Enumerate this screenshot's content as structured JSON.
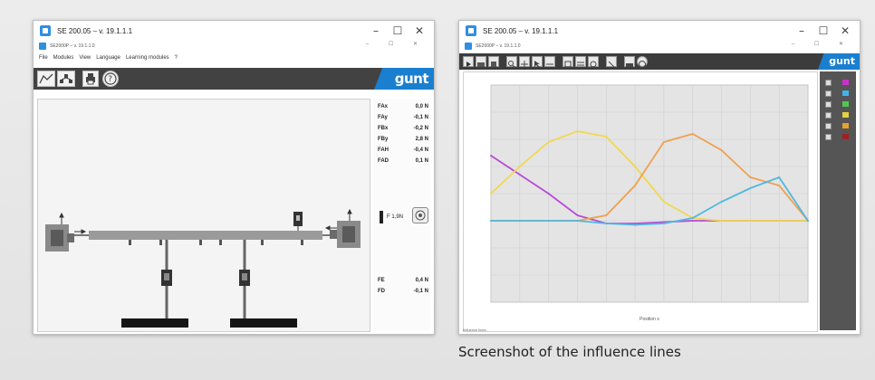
{
  "window1": {
    "title": "SE 200.05 – v. 19.1.1.1",
    "subtitle": "SE2000P – v. 19.1.1.0",
    "menu": [
      "File",
      "Modules",
      "View",
      "Language",
      "Learning modules",
      "?"
    ],
    "readouts_top": [
      {
        "label": "FAx",
        "value": "0,0 N"
      },
      {
        "label": "FAy",
        "value": "-0,1 N"
      },
      {
        "label": "FBx",
        "value": "-0,2 N"
      },
      {
        "label": "FBy",
        "value": "2,8 N"
      },
      {
        "label": "FAH",
        "value": "-0,4 N"
      },
      {
        "label": "FAD",
        "value": "0,1 N"
      }
    ],
    "readout_mid": "F 1,9N",
    "readouts_bottom": [
      {
        "label": "FE",
        "value": "0,4 N"
      },
      {
        "label": "FD",
        "value": "-0,1 N"
      }
    ],
    "logo": "gunt"
  },
  "window2": {
    "title": "SE 200.05 – v. 19.1.1.1",
    "subtitle": "SE2000P – v. 19.1.1.0",
    "logo": "gunt",
    "status": "Influence lines",
    "legend_colors": [
      "#ffffff",
      "#c832c8",
      "#40b4e8",
      "#50c850",
      "#e8d040",
      "#e8a030",
      "#a02020"
    ]
  },
  "chart_data": {
    "type": "line",
    "xlabel": "Position x",
    "x": [
      0,
      1,
      2,
      3,
      4,
      5,
      6,
      7,
      8,
      9,
      10,
      11
    ],
    "series": [
      {
        "color": "#b84ad8",
        "values": [
          2.4,
          1.7,
          1.0,
          0.2,
          -0.1,
          -0.1,
          -0.05,
          0.0,
          0.0,
          0.0,
          0.0,
          0.0
        ]
      },
      {
        "color": "#f0d850",
        "values": [
          1.0,
          2.0,
          2.9,
          3.3,
          3.1,
          2.0,
          0.7,
          0.1,
          0.0,
          0.0,
          0.0,
          0.0
        ]
      },
      {
        "color": "#f0a050",
        "values": [
          0.0,
          0.0,
          0.0,
          0.0,
          0.2,
          1.3,
          2.9,
          3.2,
          2.6,
          1.6,
          1.3,
          0.0
        ]
      },
      {
        "color": "#50b8e0",
        "values": [
          0.0,
          0.0,
          0.0,
          0.0,
          -0.1,
          -0.15,
          -0.1,
          0.1,
          0.7,
          1.2,
          1.6,
          0.0
        ]
      }
    ],
    "ylim": [
      -3,
      5
    ]
  },
  "caption": "Screenshot of the influence lines"
}
